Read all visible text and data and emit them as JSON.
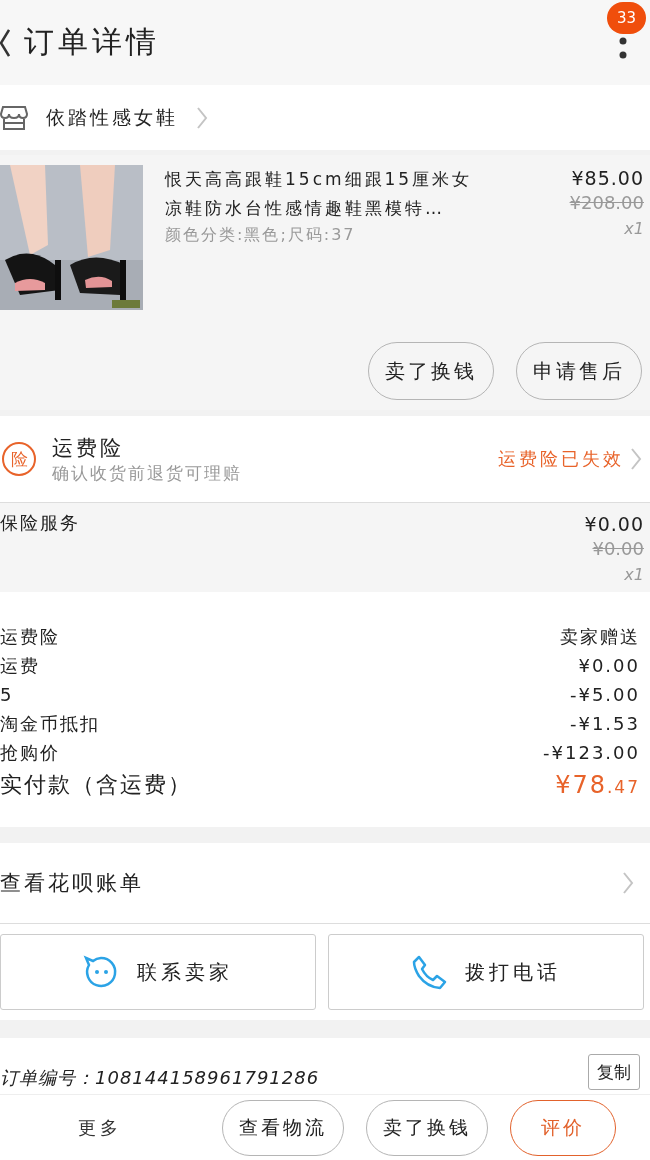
{
  "header": {
    "title": "订单详情",
    "badge": "33"
  },
  "shop": {
    "name": "依踏性感女鞋"
  },
  "item": {
    "title": "恨天高高跟鞋15cm细跟15厘米女凉鞋防水台性感情趣鞋黑模特…",
    "spec": "颜色分类:黑色;尺码:37",
    "price": "¥85.00",
    "original_price": "¥208.00",
    "quantity": "x1",
    "actions": [
      {
        "label": "卖了换钱"
      },
      {
        "label": "申请售后"
      }
    ]
  },
  "insurance": {
    "icon_text": "险",
    "title": "运费险",
    "subtitle": "确认收货前退货可理赔",
    "status": "运费险已失效"
  },
  "service": {
    "name": "保险服务",
    "price": "¥0.00",
    "original_price": "¥0.00",
    "quantity": "x1"
  },
  "summary": [
    {
      "label": "运费险",
      "value": "卖家赠送",
      "kind": "normal"
    },
    {
      "label": "运费",
      "value": "¥0.00",
      "kind": "normal"
    },
    {
      "label": "5",
      "value": "-¥5.00",
      "kind": "normal"
    },
    {
      "label": "淘金币抵扣",
      "value": "-¥1.53",
      "kind": "normal"
    },
    {
      "label": "抢购价",
      "value": "-¥123.00",
      "kind": "normal"
    },
    {
      "label": "实付款（含运费）",
      "value": "¥78.47",
      "kind": "total"
    }
  ],
  "huabei": {
    "label": "查看花呗账单"
  },
  "contact": [
    {
      "label": "联系卖家",
      "kind": "chat"
    },
    {
      "label": "拨打电话",
      "kind": "phone"
    }
  ],
  "order": {
    "number": "订单编号：108144158961791286",
    "copy": "复制"
  },
  "bottom": {
    "more": "更多",
    "buttons": [
      {
        "label": "查看物流",
        "highlighted": false
      },
      {
        "label": "卖了换钱",
        "highlighted": false
      },
      {
        "label": "评价",
        "highlighted": true
      }
    ]
  }
}
